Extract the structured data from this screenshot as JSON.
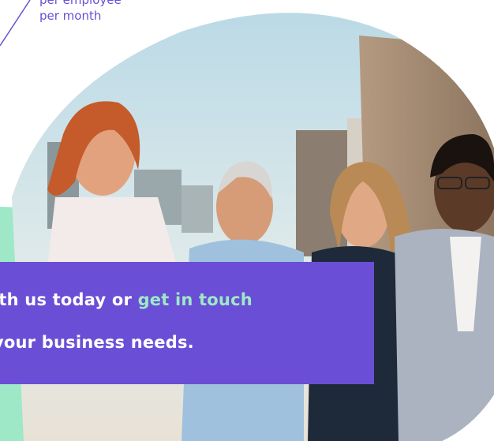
{
  "pricing_caption": {
    "line1": "per employee",
    "line2": "per month"
  },
  "cta": {
    "text_before": "ith us today or ",
    "link_text": "get in touch",
    "line2": "your business needs."
  },
  "colors": {
    "brand_purple": "#6a4fd6",
    "mint": "#9ee8c7",
    "sky": "#cfe4ec"
  },
  "image": {
    "subject": "four smiling women walking outdoors on a rooftop"
  }
}
